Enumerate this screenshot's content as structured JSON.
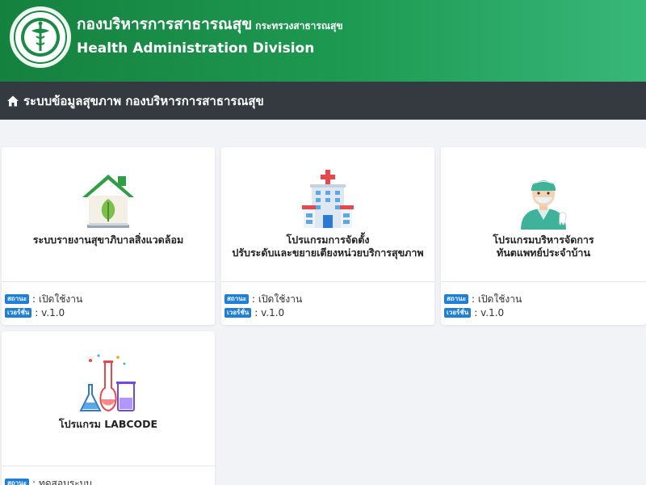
{
  "header": {
    "org_name_th": "กองบริหารการสาธารณสุข",
    "ministry_th": "กระทรวงสาธารณสุข",
    "org_name_en": "Health Administration Division",
    "logo_icon": "ministry-of-public-health-seal-icon"
  },
  "navbar": {
    "home_icon": "home-icon",
    "title": "ระบบข้อมูลสุขภาพ กองบริหารการสาธารณสุข"
  },
  "cards": [
    {
      "title_line1": "ระบบรายงานสุขาภิบาลสิ่งแวดล้อม",
      "title_line2": "",
      "icon": "green-house-leaf-icon",
      "status_label": "สถานะ",
      "status_value": ": เปิดใช้งาน",
      "version_label": "เวอร์ชั่น",
      "version_value": ": v.1.0"
    },
    {
      "title_line1": "โปรแกรมการจัดตั้ง",
      "title_line2": "ปรับระดับและขยายเตียงหน่วยบริการสุขภาพ",
      "icon": "hospital-building-icon",
      "status_label": "สถานะ",
      "status_value": ": เปิดใช้งาน",
      "version_label": "เวอร์ชั่น",
      "version_value": ": v.1.0"
    },
    {
      "title_line1": "โปรแกรมบริหารจัดการ",
      "title_line2": "ทันตแพทย์ประจำบ้าน",
      "icon": "dentist-doctor-icon",
      "status_label": "สถานะ",
      "status_value": ": เปิดใช้งาน",
      "version_label": "เวอร์ชั่น",
      "version_value": ": v.1.0"
    },
    {
      "title_line1": "โปรแกรม LABCODE",
      "title_line2": "",
      "icon": "lab-flasks-icon",
      "status_label": "สถานะ",
      "status_value": ": ทดสอบระบบ"
    }
  ],
  "colors": {
    "header_start": "#15813f",
    "header_end": "#38b77a",
    "navbar_bg": "#343a40",
    "badge_bg": "#1f7fd6",
    "page_bg": "#f1f3f6"
  }
}
